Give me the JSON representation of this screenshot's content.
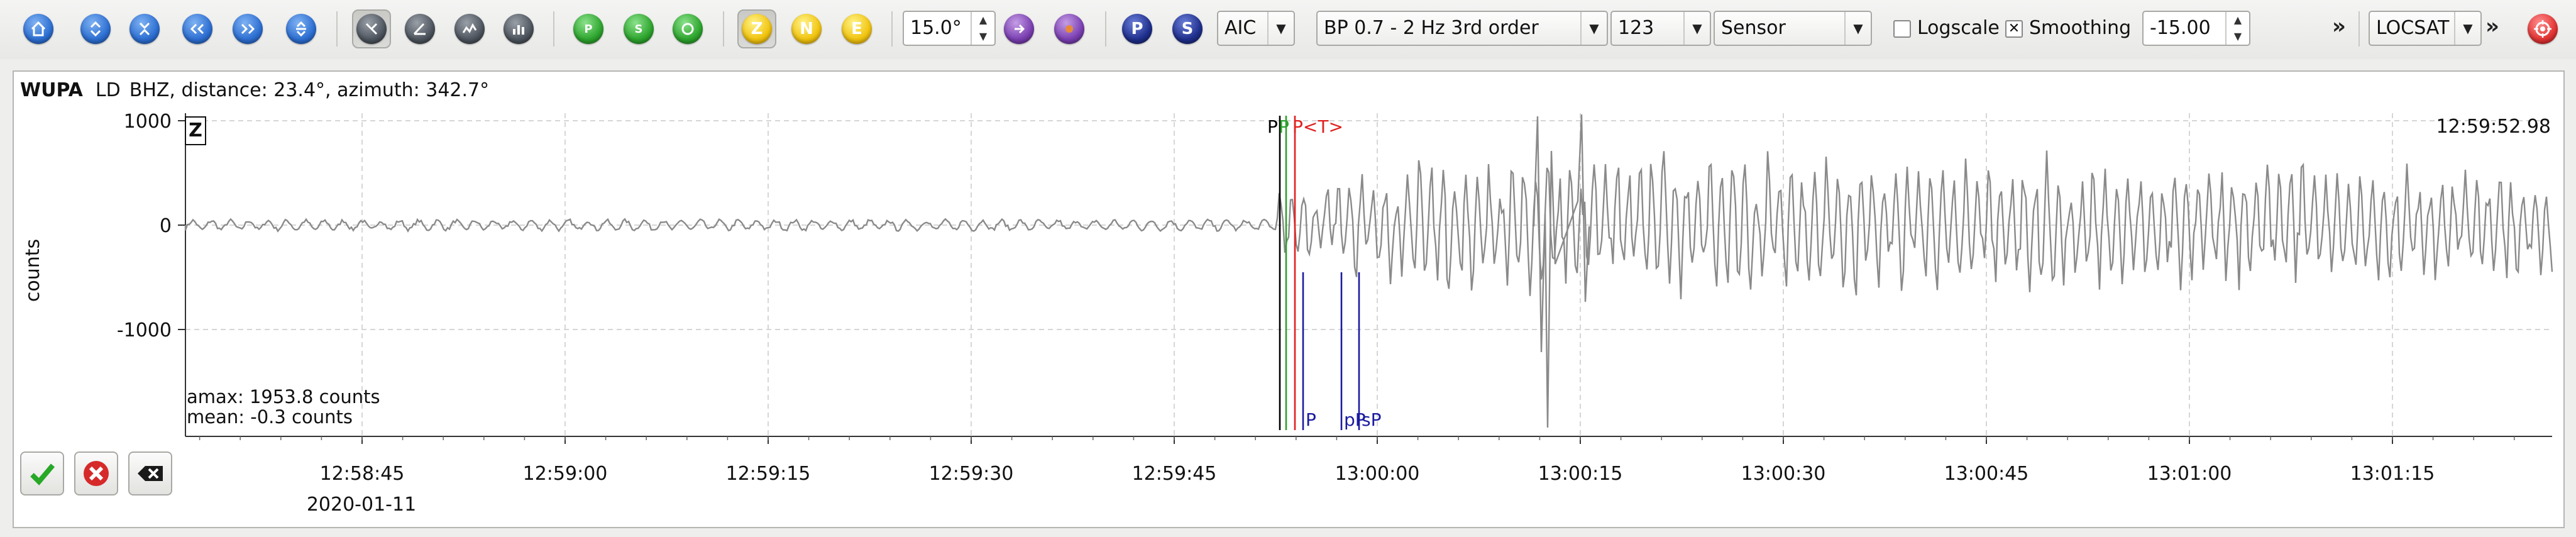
{
  "toolbar": {
    "filter_value": "15.0°",
    "picker": "AIC",
    "filter": "BP 0.7 - 2 Hz  3rd order",
    "channel_group": "123",
    "sensor": "Sensor",
    "logscale_label": "Logscale",
    "logscale_checked": false,
    "smoothing_label": "Smoothing",
    "smoothing_checked": true,
    "offset_value": "-15.00",
    "locator": "LOCSAT",
    "overflow_glyph": "»",
    "component_buttons": [
      "Z",
      "N",
      "E"
    ],
    "phase_buttons": [
      "P",
      "S"
    ]
  },
  "station": {
    "code": "WUPA",
    "network": "LD",
    "info": "BHZ, distance: 23.4°, azimuth: 342.7°"
  },
  "trace": {
    "component_label": "Z",
    "time_label": "12:59:52.98",
    "amax": "amax: 1953.8 counts",
    "mean": "mean: -0.3 counts",
    "ylabel": "counts",
    "date": "2020-01-11",
    "yticks": [
      "1000",
      "0",
      "-1000"
    ],
    "xticks": [
      "12:58:45",
      "12:59:00",
      "12:59:15",
      "12:59:30",
      "12:59:45",
      "13:00:00",
      "13:00:15",
      "13:00:30",
      "13:00:45",
      "13:01:00",
      "13:01:15"
    ],
    "top_picks": [
      "P",
      "P",
      "P<T>"
    ],
    "bottom_picks": [
      "P",
      "pP",
      "sP"
    ],
    "colors": {
      "trace": "#8a8a8a",
      "pick_black": "#000000",
      "pick_green": "#2ca02c",
      "pick_red": "#e02020",
      "pick_blue": "#1a1aa0",
      "grid": "#d6d6d6"
    }
  },
  "actions": {
    "accept": "accept-icon",
    "reject": "reject-icon",
    "clear": "clear-icon"
  }
}
